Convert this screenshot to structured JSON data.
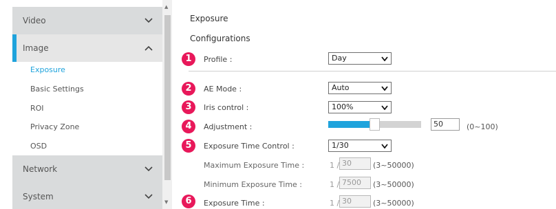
{
  "sidebar": {
    "groups": [
      {
        "label": "Video"
      },
      {
        "label": "Image"
      },
      {
        "label": "Network"
      },
      {
        "label": "System"
      }
    ],
    "sub_items": [
      {
        "label": "Exposure"
      },
      {
        "label": "Basic Settings"
      },
      {
        "label": "ROI"
      },
      {
        "label": "Privacy Zone"
      },
      {
        "label": "OSD"
      }
    ],
    "accent_color": "#1fa3dc"
  },
  "main": {
    "title": "Exposure",
    "section": "Configurations",
    "badge_color": "#e8185a",
    "badges": [
      "1",
      "2",
      "3",
      "4",
      "5",
      "6"
    ],
    "profile": {
      "label": "Profile :",
      "value": "Day"
    },
    "ae_mode": {
      "label": "AE Mode :",
      "value": "Auto"
    },
    "iris": {
      "label": "Iris control :",
      "value": "100%"
    },
    "adjustment": {
      "label": "Adjustment :",
      "value": "50",
      "range": "(0~100)",
      "level_percent": 50
    },
    "exposure_time_control": {
      "label": "Exposure Time Control :",
      "value": "1/30"
    },
    "max_exposure": {
      "label": "Maximum Exposure Time :",
      "prefix": "1 /",
      "value": "30",
      "range": "(3~50000)"
    },
    "min_exposure": {
      "label": "Minimum Exposure Time :",
      "prefix": "1 /",
      "value": "7500",
      "range": "(3~50000)"
    },
    "exposure_time": {
      "label": "Exposure Time :",
      "prefix": "1 /",
      "value": "30",
      "range": "(3~50000)"
    }
  }
}
